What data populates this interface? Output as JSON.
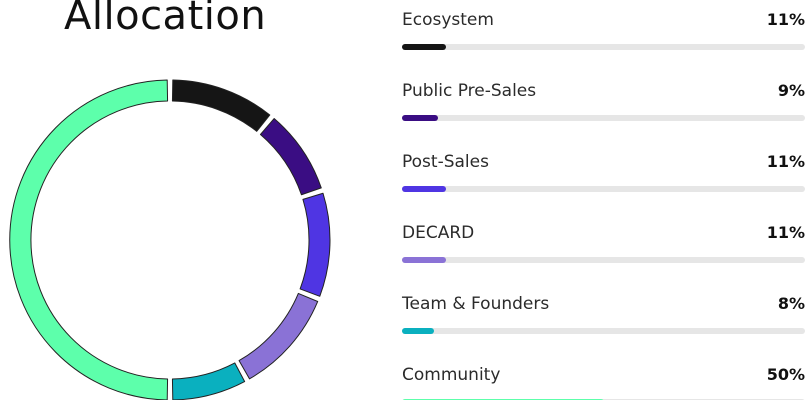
{
  "header": {
    "title": "Allocation"
  },
  "chart_data": {
    "type": "pie",
    "title": "Allocation",
    "categories": [
      "Ecosystem",
      "Public Pre-Sales",
      "Post-Sales",
      "DECARD",
      "Team & Founders",
      "Community"
    ],
    "values": [
      11,
      9,
      11,
      11,
      8,
      50
    ],
    "value_labels": [
      "11%",
      "9%",
      "11%",
      "11%",
      "8%",
      "50%"
    ],
    "colors": [
      "#151515",
      "#3a0d83",
      "#4f35e3",
      "#8a72d6",
      "#0ab0bf",
      "#5dffab"
    ],
    "style": "donut",
    "legend_placement": "right"
  }
}
